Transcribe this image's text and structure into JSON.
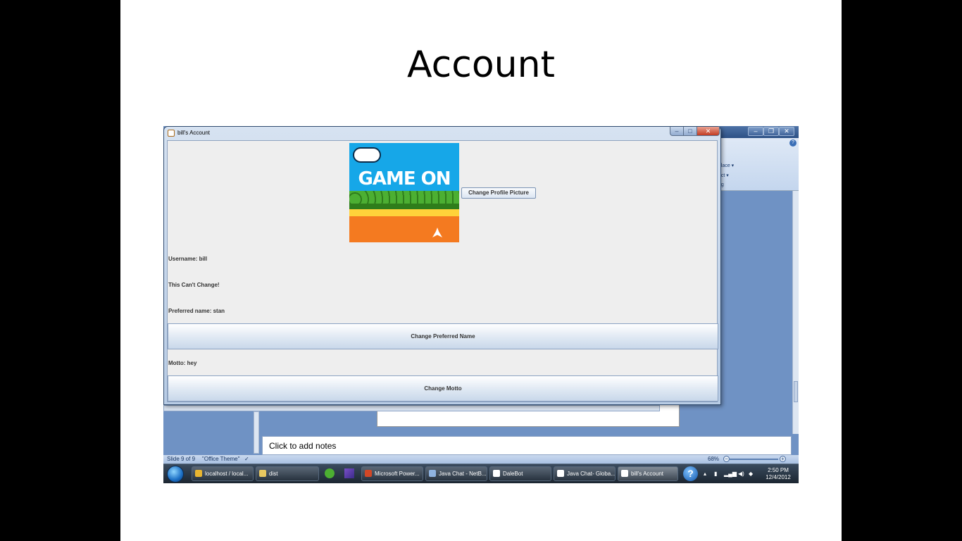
{
  "slide": {
    "title": "Account"
  },
  "java_window": {
    "title": "bill's Account",
    "profile_image_text": "GAME ON",
    "change_picture_label": "Change Profile Picture",
    "username_text": "Username: bill",
    "username_note": "This Can't Change!",
    "preferred_name_text": "Preferred name: stan",
    "change_preferred_label": "Change Preferred Name",
    "motto_text": "Motto: hey",
    "change_motto_label": "Change Motto"
  },
  "powerpoint": {
    "ribbon_items": [
      "d",
      "place ▾",
      "ect ▾",
      "ng"
    ],
    "notes_placeholder": "Click to add notes",
    "status": {
      "slide_info": "Slide 9 of 9",
      "theme": "\"Office Theme\"",
      "zoom": "68%"
    }
  },
  "taskbar": {
    "items": [
      {
        "label": "localhost / local...",
        "color": "#e8b530"
      },
      {
        "label": "dist",
        "color": "#e8c860"
      },
      {
        "label": "Microsoft Power...",
        "color": "#d24726"
      },
      {
        "label": "Java Chat - NetB...",
        "color": "#8fb3e0"
      },
      {
        "label": "DaleBot",
        "color": "#ffffff"
      },
      {
        "label": "Java Chat- Globa...",
        "color": "#ffffff"
      },
      {
        "label": "bill's Account",
        "color": "#ffffff"
      }
    ],
    "clock_time": "2:50 PM",
    "clock_date": "12/4/2012"
  },
  "colors": {
    "accent": "#16a7e8",
    "orange": "#f47a20",
    "taskbar": "#1c2631"
  }
}
